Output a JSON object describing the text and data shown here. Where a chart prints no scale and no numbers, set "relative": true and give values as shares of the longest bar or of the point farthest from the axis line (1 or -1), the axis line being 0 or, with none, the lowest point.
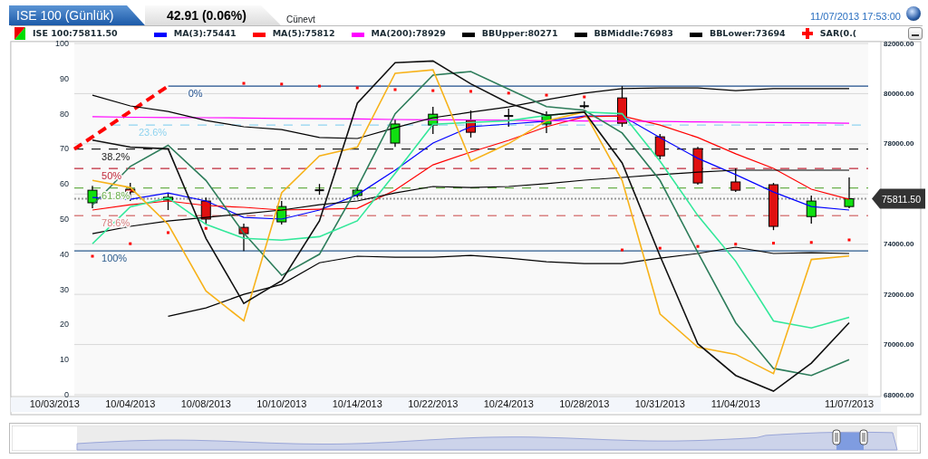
{
  "tabs": [
    {
      "label": "ISE 100 (Günlük)",
      "selected": true
    },
    {
      "label": "42.91 (0.06%)",
      "selected": false
    }
  ],
  "header_text": "Cünevt",
  "timestamp": "11/07/2013 17:53:00",
  "legend": [
    {
      "kind": "candle",
      "label": "ISE 100:75811.50"
    },
    {
      "kind": "line",
      "label": "MA(3):75441",
      "color": "#0000ff"
    },
    {
      "kind": "line",
      "label": "MA(5):75812",
      "color": "#ff0000"
    },
    {
      "kind": "line",
      "label": "MA(200):78929",
      "color": "#ff00ff"
    },
    {
      "kind": "line",
      "label": "BBUpper:80271",
      "color": "#000000"
    },
    {
      "kind": "line",
      "label": "BBMiddle:76983",
      "color": "#000000"
    },
    {
      "kind": "line",
      "label": "BBLower:73694",
      "color": "#000000"
    },
    {
      "kind": "cross",
      "label": "SAR(0.(",
      "color": "#ff0000"
    }
  ],
  "price_chart": {
    "chart_data": {
      "type": "candlestick",
      "categories": [
        "10/03/2013",
        null,
        "10/04/2013",
        null,
        "10/08/2013",
        null,
        "10/10/2013",
        null,
        "10/14/2013",
        null,
        "10/22/2013",
        null,
        "10/24/2013",
        null,
        "10/28/2013",
        null,
        "10/31/2013",
        null,
        "11/04/2013",
        null,
        null,
        "11/07/2013"
      ],
      "ylim": [
        68000,
        82000
      ],
      "grid": true,
      "yticks": [
        {
          "value": 68000,
          "label": "68000.00"
        },
        {
          "value": 70000,
          "label": "70000.00"
        },
        {
          "value": 72000,
          "label": "72000.00"
        },
        {
          "value": 74000,
          "label": "74000.00"
        },
        {
          "value": 78000,
          "label": "78000.00"
        },
        {
          "value": 80000,
          "label": "80000.00"
        },
        {
          "value": 82000,
          "label": "82000.00"
        }
      ],
      "ohlc": [
        null,
        [
          75650,
          76330,
          75430,
          76150
        ],
        [
          76190,
          76440,
          75720,
          76080
        ],
        [
          75760,
          76050,
          75360,
          75870
        ],
        [
          75720,
          75860,
          74780,
          75000
        ],
        [
          74670,
          74820,
          73730,
          74420
        ],
        [
          74890,
          75720,
          74780,
          75500
        ],
        [
          76150,
          76400,
          75970,
          76150
        ],
        [
          75940,
          76260,
          75860,
          76150
        ],
        [
          78030,
          78970,
          77880,
          78790
        ],
        [
          78750,
          79470,
          78390,
          79180
        ],
        [
          78930,
          79330,
          78250,
          78460
        ],
        [
          79110,
          79400,
          78680,
          79110
        ],
        [
          78790,
          79290,
          78430,
          79150
        ],
        [
          79500,
          79690,
          79400,
          79500
        ],
        [
          79830,
          80300,
          78680,
          78820
        ],
        [
          78280,
          78390,
          77380,
          77520
        ],
        [
          77810,
          77880,
          76370,
          76440
        ],
        [
          76480,
          77020,
          76080,
          76150
        ],
        [
          76370,
          76440,
          74560,
          74710
        ],
        [
          75100,
          75940,
          74820,
          75720
        ],
        [
          75500,
          76660,
          75430,
          75810
        ]
      ],
      "annotations": [
        "0%",
        "23.6%",
        "38.2%",
        "50%",
        "61.8%",
        "78.6%",
        "100%",
        "75811.50"
      ]
    }
  },
  "indicator_chart": {
    "chart_data": {
      "type": "line",
      "relative": true,
      "ylim": [
        68000,
        82000
      ],
      "series": [
        {
          "color": "#0000ff",
          "values": [
            null,
            75860,
            75790,
            76040,
            75720,
            75070,
            75000,
            75360,
            75970,
            76950,
            78030,
            78680,
            78790,
            78900,
            79110,
            79110,
            78250,
            77420,
            76770,
            76080,
            75500,
            75360
          ]
        },
        {
          "color": "#ff0000",
          "values": [
            null,
            75360,
            75570,
            75720,
            75540,
            75470,
            75360,
            75390,
            75430,
            76150,
            77160,
            77670,
            78140,
            78680,
            79080,
            79110,
            78750,
            78250,
            77600,
            77020,
            76190,
            75790
          ]
        },
        {
          "color": "#ff00ff",
          "values": [
            null,
            79080,
            79060,
            79050,
            79040,
            79030,
            79010,
            79000,
            78990,
            78970,
            78960,
            78950,
            78940,
            78920,
            78910,
            78900,
            78890,
            78870,
            78860,
            78850,
            78840,
            78820
          ]
        },
        {
          "color": "#000000",
          "values": [
            null,
            79940,
            79510,
            79290,
            78930,
            78680,
            78570,
            78250,
            78210,
            78640,
            79040,
            79260,
            79470,
            79760,
            80020,
            80200,
            80230,
            80230,
            80120,
            80200,
            80200,
            80200
          ]
        },
        {
          "color": "#000000",
          "values": [
            null,
            74420,
            74710,
            74920,
            75070,
            75210,
            75360,
            75570,
            75720,
            76040,
            76300,
            76260,
            76300,
            76410,
            76550,
            76660,
            76770,
            76870,
            76950,
            76950,
            76950,
            76950
          ]
        },
        {
          "color": "#000000",
          "values": [
            null,
            null,
            null,
            71130,
            71460,
            72000,
            72400,
            73260,
            73520,
            73480,
            73480,
            73550,
            73440,
            73300,
            73230,
            73230,
            73440,
            73630,
            73880,
            73630,
            73660,
            73630
          ]
        },
        {
          "type": "scatter",
          "color": "#ff0000",
          "values": [
            null,
            73520,
            74020,
            74460,
            74630,
            80410,
            80380,
            80300,
            80230,
            80160,
            80120,
            80090,
            80020,
            79940,
            79870,
            73770,
            73840,
            73910,
            74000,
            74040,
            74070,
            74170
          ]
        }
      ]
    }
  },
  "oscillator_chart": {
    "chart_data": {
      "type": "line",
      "ylim": [
        0,
        100
      ],
      "yticks": [
        0,
        10,
        20,
        30,
        40,
        50,
        60,
        70,
        80,
        90,
        100
      ],
      "series": [
        {
          "color": "#2e7d5b",
          "values": [
            null,
            54,
            65,
            71,
            61,
            46,
            34,
            40,
            59,
            80,
            91,
            92,
            87,
            82,
            81,
            74.5,
            61,
            40.5,
            20.5,
            7.5,
            5.5,
            10
          ]
        },
        {
          "color": "#33e89a",
          "values": [
            null,
            43,
            53.5,
            56,
            48.5,
            44.5,
            44,
            45,
            49.5,
            63,
            77,
            77.5,
            78,
            79.5,
            80.5,
            80,
            66.5,
            51,
            38,
            21,
            19,
            22
          ]
        },
        {
          "color": "#f7b21a",
          "values": [
            null,
            61,
            59,
            48.5,
            29.5,
            21,
            57.5,
            68,
            70.5,
            91.5,
            92.5,
            66.5,
            71.5,
            78,
            80.5,
            61,
            23,
            13.5,
            11.5,
            6,
            38.5,
            39.5
          ]
        },
        {
          "color": "#111111",
          "values": [
            null,
            72.5,
            70.5,
            70,
            44.5,
            26,
            32.5,
            49.5,
            83,
            94.5,
            95,
            88.5,
            83,
            79.5,
            80.5,
            66,
            39.5,
            14.5,
            5.5,
            1,
            9,
            20.5
          ]
        }
      ]
    }
  }
}
